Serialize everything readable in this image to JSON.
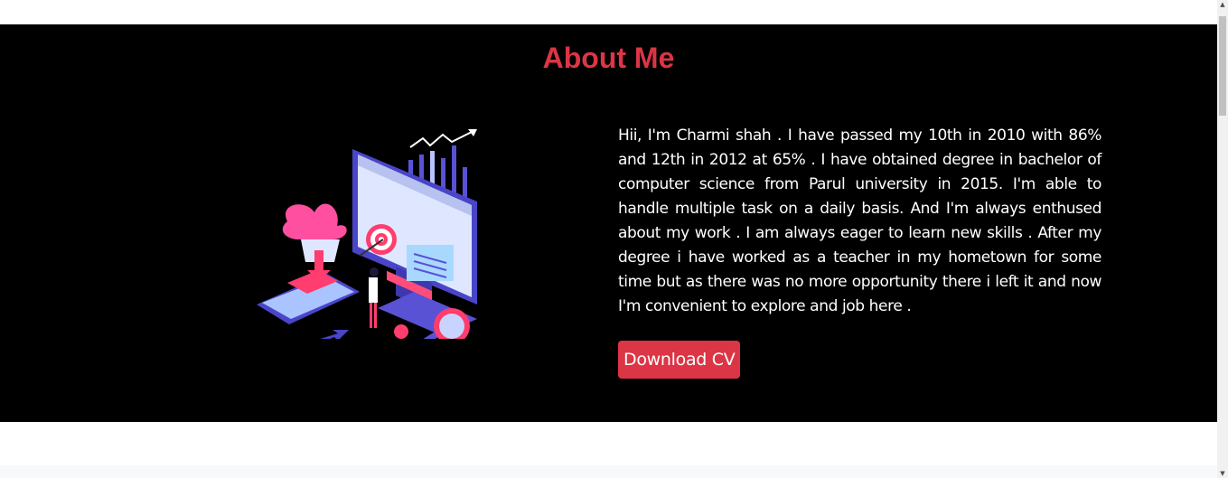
{
  "about": {
    "title": "About Me",
    "bio": "Hii, I'm Charmi shah . I have passed my 10th in 2010 with 86% and 12th in 2012 at 65% . I have obtained degree in bachelor of computer science from Parul university in 2015. I'm able to handle multiple task on a daily basis. And I'm always enthused about my work . I am always eager to learn new skills . After my degree i have worked as a teacher in my hometown for some time but as there was no more opportunity there i left it and now I'm convenient to explore and job here .",
    "download_label": "Download CV",
    "illustration_icon": "marketing-target-illustration"
  },
  "scrollbar": {
    "up_icon": "scroll-up-arrow-icon",
    "down_icon": "scroll-down-arrow-icon"
  },
  "colors": {
    "accent": "#dc3545",
    "section_bg": "#000000",
    "text": "#ffffff"
  }
}
